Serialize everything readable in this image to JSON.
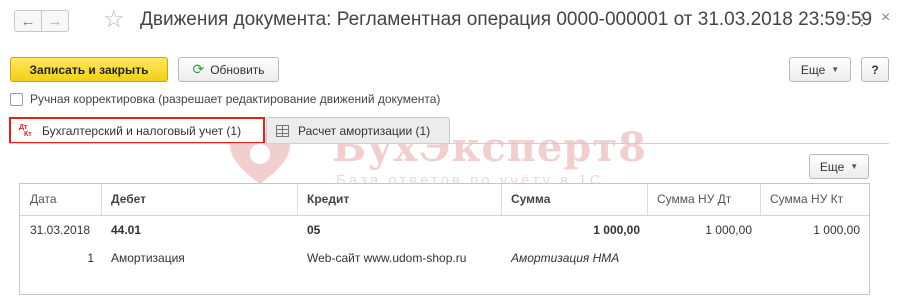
{
  "window": {
    "title": "Движения документа: Регламентная операция 0000-000001 от 31.03.2018 23:59:59",
    "nav_back_icon": "arrow-left-icon",
    "nav_forward_icon": "arrow-right-icon",
    "favorite_icon": "star-icon",
    "more_glyph": "⋮",
    "close_glyph": "×"
  },
  "toolbar": {
    "save_close_label": "Записать и закрыть",
    "refresh_label": "Обновить",
    "refresh_icon": "refresh-icon",
    "more_label": "Еще",
    "help_label": "?"
  },
  "manual_correction": {
    "checked": false,
    "label": "Ручная корректировка (разрешает редактирование движений документа)"
  },
  "tabs": [
    {
      "label": "Бухгалтерский и налоговый учет (1)",
      "icon": "dt-kt-icon",
      "icon_top": "Дт",
      "icon_bottom": "Кт",
      "active": true
    },
    {
      "label": "Расчет амортизации (1)",
      "icon": "table-grid-icon",
      "active": false
    }
  ],
  "watermark": {
    "brand": "БухЭксперт8",
    "subtitle": "База ответов по учёту в 1С"
  },
  "table_toolbar": {
    "more_label": "Еще"
  },
  "table": {
    "columns": [
      "Дата",
      "Дебет",
      "Кредит",
      "Сумма",
      "Сумма НУ Дт",
      "Сумма НУ Кт"
    ],
    "rows": [
      {
        "date": "31.03.2018",
        "line_no": "1",
        "debit": "44.01",
        "debit_sub": "Амортизация",
        "credit": "05",
        "credit_sub": "Web-сайт www.udom-shop.ru",
        "amount": "1 000,00",
        "amount_sub": "Амортизация НМА",
        "nu_dt": "1 000,00",
        "nu_kt": "1 000,00"
      }
    ]
  },
  "colors": {
    "primary_button": "#f2cf17",
    "active_tab_border": "#e0221b",
    "watermark": "#d05555"
  }
}
